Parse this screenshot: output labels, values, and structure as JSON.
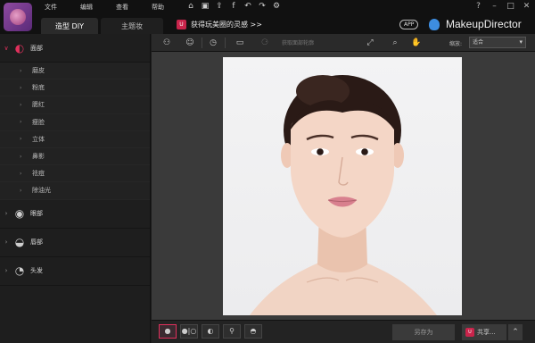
{
  "menu": [
    "文件",
    "编辑",
    "查看",
    "帮助"
  ],
  "tabs": {
    "diy": "造型 DIY",
    "theme": "主题妆"
  },
  "promo": {
    "badge": "U",
    "text": "获得玩美圈的灵感 >>"
  },
  "app_badge": "APP",
  "brand": "MakeupDirector",
  "categories": [
    {
      "label": "面部",
      "icon": "face-icon",
      "expanded": true,
      "subitems": [
        "磨皮",
        "粉底",
        "腮红",
        "瘦脸",
        "立体",
        "鼻影",
        "祛痘",
        "除油光"
      ]
    },
    {
      "label": "眼部",
      "icon": "eye-icon"
    },
    {
      "label": "唇部",
      "icon": "lips-icon"
    },
    {
      "label": "头发",
      "icon": "hair-icon"
    }
  ],
  "toolbar": {
    "auto_detect": "获取面部轮廓",
    "zoom_label": "缩放:",
    "zoom_value": "适合"
  },
  "bottom": {
    "save_as": "另存为",
    "share": "共享...",
    "share_badge": "U"
  },
  "colors": {
    "accent": "#e0305c",
    "brand_blue": "#3d8de0"
  }
}
